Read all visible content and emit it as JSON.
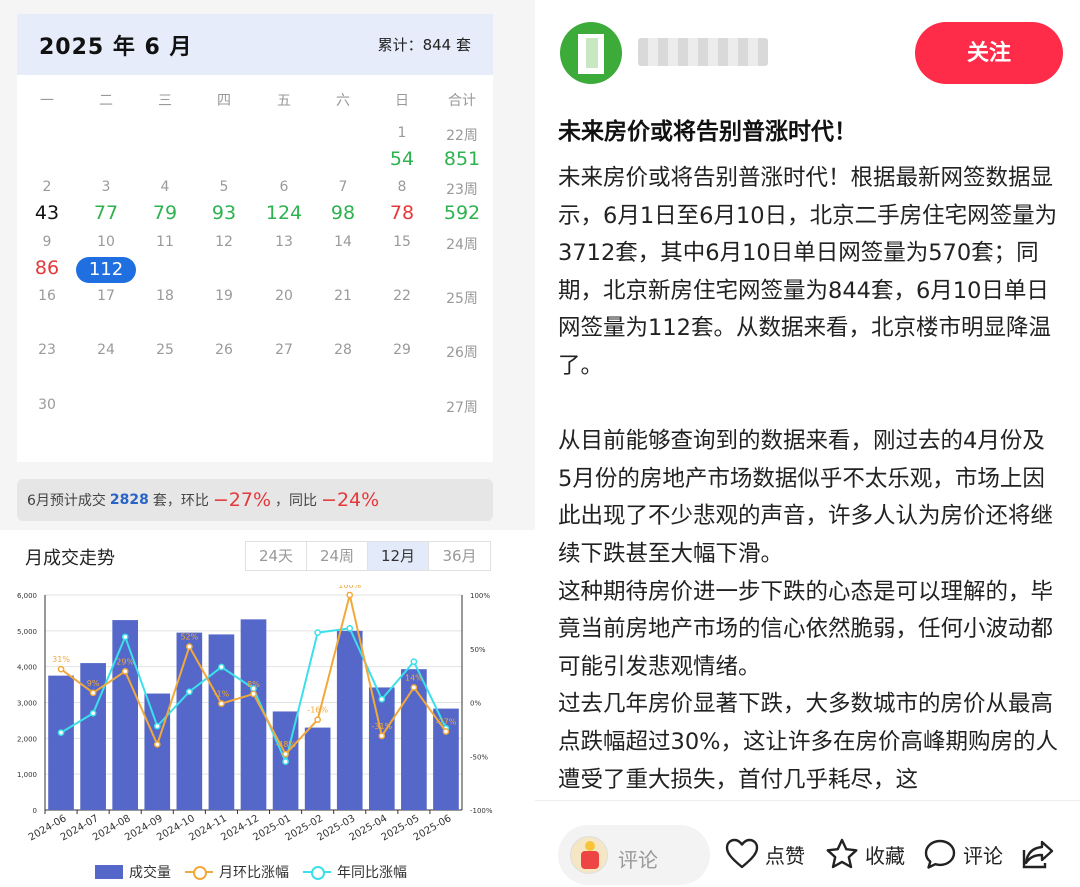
{
  "calendar": {
    "title": "2025 年 6 月",
    "total": "累计：844 套",
    "weekdays": [
      "一",
      "二",
      "三",
      "四",
      "五",
      "六",
      "日",
      "合计"
    ],
    "rows": [
      {
        "days": [
          "",
          "",
          "",
          "",
          "",
          "",
          "1"
        ],
        "week": "22周",
        "values": [
          {
            "text": "",
            "color": ""
          },
          {
            "text": "",
            "color": ""
          },
          {
            "text": "",
            "color": ""
          },
          {
            "text": "",
            "color": ""
          },
          {
            "text": "",
            "color": ""
          },
          {
            "text": "",
            "color": ""
          },
          {
            "text": "54",
            "color": "green"
          }
        ],
        "sum": {
          "text": "851",
          "color": "green"
        }
      },
      {
        "days": [
          "2",
          "3",
          "4",
          "5",
          "6",
          "7",
          "8"
        ],
        "week": "23周",
        "values": [
          {
            "text": "43",
            "color": "black"
          },
          {
            "text": "77",
            "color": "green"
          },
          {
            "text": "79",
            "color": "green"
          },
          {
            "text": "93",
            "color": "green"
          },
          {
            "text": "124",
            "color": "green"
          },
          {
            "text": "98",
            "color": "green"
          },
          {
            "text": "78",
            "color": "red"
          }
        ],
        "sum": {
          "text": "592",
          "color": "green"
        }
      },
      {
        "days": [
          "9",
          "10",
          "11",
          "12",
          "13",
          "14",
          "15"
        ],
        "week": "24周",
        "values": [
          {
            "text": "86",
            "color": "red"
          },
          {
            "text": "112",
            "color": "sel"
          },
          {
            "text": "",
            "color": ""
          },
          {
            "text": "",
            "color": ""
          },
          {
            "text": "",
            "color": ""
          },
          {
            "text": "",
            "color": ""
          },
          {
            "text": "",
            "color": ""
          }
        ],
        "sum": {
          "text": "",
          "color": ""
        }
      },
      {
        "days": [
          "16",
          "17",
          "18",
          "19",
          "20",
          "21",
          "22"
        ],
        "week": "25周",
        "values": [],
        "sum": {
          "text": "",
          "color": ""
        }
      },
      {
        "days": [
          "23",
          "24",
          "25",
          "26",
          "27",
          "28",
          "29"
        ],
        "week": "26周",
        "values": [],
        "sum": {
          "text": "",
          "color": ""
        }
      },
      {
        "days": [
          "30",
          "",
          "",
          "",
          "",
          "",
          ""
        ],
        "week": "27周",
        "values": [],
        "sum": {
          "text": "",
          "color": ""
        }
      }
    ]
  },
  "forecast": {
    "prefix": "6月预计成交",
    "count": "2828",
    "mid": "套，环比",
    "mom": "−27%",
    "sep": "，同比",
    "yoy": "−24%"
  },
  "trend": {
    "title": "月成交走势",
    "tabs": [
      "24天",
      "24周",
      "12月",
      "36月"
    ],
    "active_tab": "12月"
  },
  "chart_data": {
    "type": "bar",
    "categories": [
      "2024-06",
      "2024-07",
      "2024-08",
      "2024-09",
      "2024-10",
      "2024-11",
      "2024-12",
      "2025-01",
      "2025-02",
      "2025-03",
      "2025-04",
      "2025-05",
      "2025-06"
    ],
    "series": [
      {
        "name": "成交量",
        "type": "bar",
        "axis": "left",
        "color": "#5567c8",
        "values": [
          3750,
          4100,
          5300,
          3250,
          4950,
          4900,
          5320,
          2750,
          2300,
          5000,
          3420,
          3930,
          2830
        ]
      },
      {
        "name": "月环比涨幅",
        "type": "line",
        "axis": "right",
        "color": "#f2a93b",
        "values": [
          31,
          9,
          29,
          -39,
          52,
          -1,
          8,
          -48,
          -16,
          100,
          -31,
          14,
          -27
        ],
        "labels": [
          "31%",
          "9%",
          "29%",
          "",
          "52%",
          "-1%",
          "8%",
          "-48%",
          "-16%",
          "100%",
          "-31%",
          "14%",
          "-27%"
        ]
      },
      {
        "name": "年同比涨幅",
        "type": "line",
        "axis": "right",
        "color": "#3be0ea",
        "values": [
          -28,
          -10,
          61,
          -22,
          10,
          33,
          13,
          -55,
          65,
          69,
          3,
          38,
          -24
        ]
      }
    ],
    "y_left": {
      "min": 0,
      "max": 6000,
      "ticks": [
        "0",
        "1,000",
        "2,000",
        "3,000",
        "4,000",
        "5,000",
        "6,000"
      ]
    },
    "y_right": {
      "min": -100,
      "max": 100,
      "ticks": [
        "-100%",
        "-50%",
        "0%",
        "50%",
        "100%"
      ]
    },
    "legend": "bottom"
  },
  "author": {
    "follow_label": "关注"
  },
  "post": {
    "title": "未来房价或将告别普涨时代！",
    "body": "未来房价或将告别普涨时代！根据最新网签数据显示，6月1日至6月10日，北京二手房住宅网签量为3712套，其中6月10日单日网签量为570套；同期，北京新房住宅网签量为844套，6月10日单日网签量为112套。从数据来看，北京楼市明显降温了。\n\n从目前能够查询到的数据来看，刚过去的4月份及5月份的房地产市场数据似乎不太乐观，市场上因此出现了不少悲观的声音，许多人认为房价还将继续下跌甚至大幅下滑。\n这种期待房价进一步下跌的心态是可以理解的，毕竟当前房地产市场的信心依然脆弱，任何小波动都可能引发悲观情绪。\n过去几年房价显著下跌，大多数城市的房价从最高点跌幅超过30%，这让许多在房价高峰期购房的人遭受了重大损失，首付几乎耗尽，这"
  },
  "bottom_bar": {
    "comment_placeholder": "评论",
    "like_label": "点赞",
    "fav_label": "收藏",
    "comment_label": "评论"
  }
}
